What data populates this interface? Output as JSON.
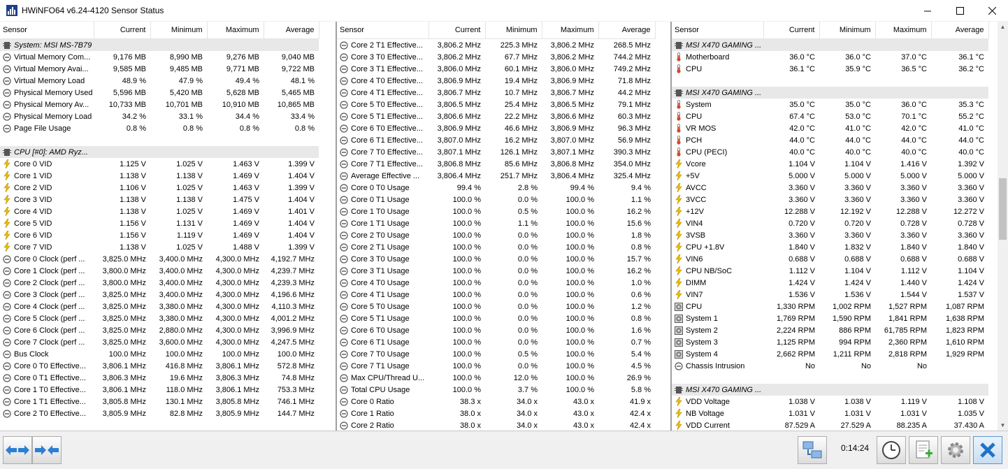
{
  "window": {
    "title": "HWiNFO64 v6.24-4120 Sensor Status"
  },
  "columns": [
    "Sensor",
    "Current",
    "Minimum",
    "Maximum",
    "Average"
  ],
  "pane1": [
    {
      "t": "g",
      "label": "System: MSI MS-7B79"
    },
    {
      "t": "r",
      "icon": "circle",
      "label": "Virtual Memory Com...",
      "cur": "9,176 MB",
      "min": "8,990 MB",
      "max": "9,276 MB",
      "avg": "9,040 MB"
    },
    {
      "t": "r",
      "icon": "circle",
      "label": "Virtual Memory Avai...",
      "cur": "9,585 MB",
      "min": "9,485 MB",
      "max": "9,771 MB",
      "avg": "9,722 MB"
    },
    {
      "t": "r",
      "icon": "circle",
      "label": "Virtual Memory Load",
      "cur": "48.9 %",
      "min": "47.9 %",
      "max": "49.4 %",
      "avg": "48.1 %"
    },
    {
      "t": "r",
      "icon": "circle",
      "label": "Physical Memory Used",
      "cur": "5,596 MB",
      "min": "5,420 MB",
      "max": "5,628 MB",
      "avg": "5,465 MB"
    },
    {
      "t": "r",
      "icon": "circle",
      "label": "Physical Memory Av...",
      "cur": "10,733 MB",
      "min": "10,701 MB",
      "max": "10,910 MB",
      "avg": "10,865 MB"
    },
    {
      "t": "r",
      "icon": "circle",
      "label": "Physical Memory Load",
      "cur": "34.2 %",
      "min": "33.1 %",
      "max": "34.4 %",
      "avg": "33.4 %"
    },
    {
      "t": "r",
      "icon": "circle",
      "label": "Page File Usage",
      "cur": "0.8 %",
      "min": "0.8 %",
      "max": "0.8 %",
      "avg": "0.8 %"
    },
    {
      "t": "s"
    },
    {
      "t": "g",
      "label": "CPU [#0]: AMD Ryz..."
    },
    {
      "t": "r",
      "icon": "bolt",
      "label": "Core 0 VID",
      "cur": "1.125 V",
      "min": "1.025 V",
      "max": "1.463 V",
      "avg": "1.399 V"
    },
    {
      "t": "r",
      "icon": "bolt",
      "label": "Core 1 VID",
      "cur": "1.138 V",
      "min": "1.138 V",
      "max": "1.469 V",
      "avg": "1.404 V"
    },
    {
      "t": "r",
      "icon": "bolt",
      "label": "Core 2 VID",
      "cur": "1.106 V",
      "min": "1.025 V",
      "max": "1.463 V",
      "avg": "1.399 V"
    },
    {
      "t": "r",
      "icon": "bolt",
      "label": "Core 3 VID",
      "cur": "1.138 V",
      "min": "1.138 V",
      "max": "1.475 V",
      "avg": "1.404 V"
    },
    {
      "t": "r",
      "icon": "bolt",
      "label": "Core 4 VID",
      "cur": "1.138 V",
      "min": "1.025 V",
      "max": "1.469 V",
      "avg": "1.401 V"
    },
    {
      "t": "r",
      "icon": "bolt",
      "label": "Core 5 VID",
      "cur": "1.156 V",
      "min": "1.131 V",
      "max": "1.469 V",
      "avg": "1.404 V"
    },
    {
      "t": "r",
      "icon": "bolt",
      "label": "Core 6 VID",
      "cur": "1.156 V",
      "min": "1.119 V",
      "max": "1.469 V",
      "avg": "1.404 V"
    },
    {
      "t": "r",
      "icon": "bolt",
      "label": "Core 7 VID",
      "cur": "1.138 V",
      "min": "1.025 V",
      "max": "1.488 V",
      "avg": "1.399 V"
    },
    {
      "t": "r",
      "icon": "circle",
      "label": "Core 0 Clock (perf ...",
      "cur": "3,825.0 MHz",
      "min": "3,400.0 MHz",
      "max": "4,300.0 MHz",
      "avg": "4,192.7 MHz"
    },
    {
      "t": "r",
      "icon": "circle",
      "label": "Core 1 Clock (perf ...",
      "cur": "3,800.0 MHz",
      "min": "3,400.0 MHz",
      "max": "4,300.0 MHz",
      "avg": "4,239.7 MHz"
    },
    {
      "t": "r",
      "icon": "circle",
      "label": "Core 2 Clock (perf ...",
      "cur": "3,800.0 MHz",
      "min": "3,400.0 MHz",
      "max": "4,300.0 MHz",
      "avg": "4,239.3 MHz"
    },
    {
      "t": "r",
      "icon": "circle",
      "label": "Core 3 Clock (perf ...",
      "cur": "3,825.0 MHz",
      "min": "3,400.0 MHz",
      "max": "4,300.0 MHz",
      "avg": "4,196.6 MHz"
    },
    {
      "t": "r",
      "icon": "circle",
      "label": "Core 4 Clock (perf ...",
      "cur": "3,825.0 MHz",
      "min": "3,380.0 MHz",
      "max": "4,300.0 MHz",
      "avg": "4,110.3 MHz"
    },
    {
      "t": "r",
      "icon": "circle",
      "label": "Core 5 Clock (perf ...",
      "cur": "3,825.0 MHz",
      "min": "3,380.0 MHz",
      "max": "4,300.0 MHz",
      "avg": "4,001.2 MHz"
    },
    {
      "t": "r",
      "icon": "circle",
      "label": "Core 6 Clock (perf ...",
      "cur": "3,825.0 MHz",
      "min": "2,880.0 MHz",
      "max": "4,300.0 MHz",
      "avg": "3,996.9 MHz"
    },
    {
      "t": "r",
      "icon": "circle",
      "label": "Core 7 Clock (perf ...",
      "cur": "3,825.0 MHz",
      "min": "3,600.0 MHz",
      "max": "4,300.0 MHz",
      "avg": "4,247.5 MHz"
    },
    {
      "t": "r",
      "icon": "circle",
      "label": "Bus Clock",
      "cur": "100.0 MHz",
      "min": "100.0 MHz",
      "max": "100.0 MHz",
      "avg": "100.0 MHz"
    },
    {
      "t": "r",
      "icon": "circle",
      "label": "Core 0 T0 Effective...",
      "cur": "3,806.1 MHz",
      "min": "416.8 MHz",
      "max": "3,806.1 MHz",
      "avg": "572.8 MHz"
    },
    {
      "t": "r",
      "icon": "circle",
      "label": "Core 0 T1 Effective...",
      "cur": "3,806.3 MHz",
      "min": "19.6 MHz",
      "max": "3,806.3 MHz",
      "avg": "74.8 MHz"
    },
    {
      "t": "r",
      "icon": "circle",
      "label": "Core 1 T0 Effective...",
      "cur": "3,806.1 MHz",
      "min": "118.0 MHz",
      "max": "3,806.1 MHz",
      "avg": "753.3 MHz"
    },
    {
      "t": "r",
      "icon": "circle",
      "label": "Core 1 T1 Effective...",
      "cur": "3,805.8 MHz",
      "min": "130.1 MHz",
      "max": "3,805.8 MHz",
      "avg": "746.1 MHz"
    },
    {
      "t": "r",
      "icon": "circle",
      "label": "Core 2 T0 Effective...",
      "cur": "3,805.9 MHz",
      "min": "82.8 MHz",
      "max": "3,805.9 MHz",
      "avg": "144.7 MHz"
    }
  ],
  "pane2": [
    {
      "t": "r",
      "icon": "circle",
      "label": "Core 2 T1 Effective...",
      "cur": "3,806.2 MHz",
      "min": "225.3 MHz",
      "max": "3,806.2 MHz",
      "avg": "268.5 MHz"
    },
    {
      "t": "r",
      "icon": "circle",
      "label": "Core 3 T0 Effective...",
      "cur": "3,806.2 MHz",
      "min": "67.7 MHz",
      "max": "3,806.2 MHz",
      "avg": "744.2 MHz"
    },
    {
      "t": "r",
      "icon": "circle",
      "label": "Core 3 T1 Effective...",
      "cur": "3,806.0 MHz",
      "min": "60.1 MHz",
      "max": "3,806.0 MHz",
      "avg": "749.2 MHz"
    },
    {
      "t": "r",
      "icon": "circle",
      "label": "Core 4 T0 Effective...",
      "cur": "3,806.9 MHz",
      "min": "19.4 MHz",
      "max": "3,806.9 MHz",
      "avg": "71.8 MHz"
    },
    {
      "t": "r",
      "icon": "circle",
      "label": "Core 4 T1 Effective...",
      "cur": "3,806.7 MHz",
      "min": "10.7 MHz",
      "max": "3,806.7 MHz",
      "avg": "44.2 MHz"
    },
    {
      "t": "r",
      "icon": "circle",
      "label": "Core 5 T0 Effective...",
      "cur": "3,806.5 MHz",
      "min": "25.4 MHz",
      "max": "3,806.5 MHz",
      "avg": "79.1 MHz"
    },
    {
      "t": "r",
      "icon": "circle",
      "label": "Core 5 T1 Effective...",
      "cur": "3,806.6 MHz",
      "min": "22.2 MHz",
      "max": "3,806.6 MHz",
      "avg": "60.3 MHz"
    },
    {
      "t": "r",
      "icon": "circle",
      "label": "Core 6 T0 Effective...",
      "cur": "3,806.9 MHz",
      "min": "46.6 MHz",
      "max": "3,806.9 MHz",
      "avg": "96.3 MHz"
    },
    {
      "t": "r",
      "icon": "circle",
      "label": "Core 6 T1 Effective...",
      "cur": "3,807.0 MHz",
      "min": "16.2 MHz",
      "max": "3,807.0 MHz",
      "avg": "56.9 MHz"
    },
    {
      "t": "r",
      "icon": "circle",
      "label": "Core 7 T0 Effective...",
      "cur": "3,807.1 MHz",
      "min": "126.1 MHz",
      "max": "3,807.1 MHz",
      "avg": "390.3 MHz"
    },
    {
      "t": "r",
      "icon": "circle",
      "label": "Core 7 T1 Effective...",
      "cur": "3,806.8 MHz",
      "min": "85.6 MHz",
      "max": "3,806.8 MHz",
      "avg": "354.0 MHz"
    },
    {
      "t": "r",
      "icon": "circle",
      "label": "Average Effective ...",
      "cur": "3,806.4 MHz",
      "min": "251.7 MHz",
      "max": "3,806.4 MHz",
      "avg": "325.4 MHz"
    },
    {
      "t": "r",
      "icon": "circle",
      "label": "Core 0 T0 Usage",
      "cur": "99.4 %",
      "min": "2.8 %",
      "max": "99.4 %",
      "avg": "9.4 %"
    },
    {
      "t": "r",
      "icon": "circle",
      "label": "Core 0 T1 Usage",
      "cur": "100.0 %",
      "min": "0.0 %",
      "max": "100.0 %",
      "avg": "1.1 %"
    },
    {
      "t": "r",
      "icon": "circle",
      "label": "Core 1 T0 Usage",
      "cur": "100.0 %",
      "min": "0.5 %",
      "max": "100.0 %",
      "avg": "16.2 %"
    },
    {
      "t": "r",
      "icon": "circle",
      "label": "Core 1 T1 Usage",
      "cur": "100.0 %",
      "min": "1.1 %",
      "max": "100.0 %",
      "avg": "15.6 %"
    },
    {
      "t": "r",
      "icon": "circle",
      "label": "Core 2 T0 Usage",
      "cur": "100.0 %",
      "min": "0.0 %",
      "max": "100.0 %",
      "avg": "1.8 %"
    },
    {
      "t": "r",
      "icon": "circle",
      "label": "Core 2 T1 Usage",
      "cur": "100.0 %",
      "min": "0.0 %",
      "max": "100.0 %",
      "avg": "0.8 %"
    },
    {
      "t": "r",
      "icon": "circle",
      "label": "Core 3 T0 Usage",
      "cur": "100.0 %",
      "min": "0.0 %",
      "max": "100.0 %",
      "avg": "15.7 %"
    },
    {
      "t": "r",
      "icon": "circle",
      "label": "Core 3 T1 Usage",
      "cur": "100.0 %",
      "min": "0.0 %",
      "max": "100.0 %",
      "avg": "16.2 %"
    },
    {
      "t": "r",
      "icon": "circle",
      "label": "Core 4 T0 Usage",
      "cur": "100.0 %",
      "min": "0.0 %",
      "max": "100.0 %",
      "avg": "1.0 %"
    },
    {
      "t": "r",
      "icon": "circle",
      "label": "Core 4 T1 Usage",
      "cur": "100.0 %",
      "min": "0.0 %",
      "max": "100.0 %",
      "avg": "0.6 %"
    },
    {
      "t": "r",
      "icon": "circle",
      "label": "Core 5 T0 Usage",
      "cur": "100.0 %",
      "min": "0.0 %",
      "max": "100.0 %",
      "avg": "1.2 %"
    },
    {
      "t": "r",
      "icon": "circle",
      "label": "Core 5 T1 Usage",
      "cur": "100.0 %",
      "min": "0.0 %",
      "max": "100.0 %",
      "avg": "0.8 %"
    },
    {
      "t": "r",
      "icon": "circle",
      "label": "Core 6 T0 Usage",
      "cur": "100.0 %",
      "min": "0.0 %",
      "max": "100.0 %",
      "avg": "1.6 %"
    },
    {
      "t": "r",
      "icon": "circle",
      "label": "Core 6 T1 Usage",
      "cur": "100.0 %",
      "min": "0.0 %",
      "max": "100.0 %",
      "avg": "0.7 %"
    },
    {
      "t": "r",
      "icon": "circle",
      "label": "Core 7 T0 Usage",
      "cur": "100.0 %",
      "min": "0.5 %",
      "max": "100.0 %",
      "avg": "5.4 %"
    },
    {
      "t": "r",
      "icon": "circle",
      "label": "Core 7 T1 Usage",
      "cur": "100.0 %",
      "min": "0.0 %",
      "max": "100.0 %",
      "avg": "4.5 %"
    },
    {
      "t": "r",
      "icon": "circle",
      "label": "Max CPU/Thread U...",
      "cur": "100.0 %",
      "min": "12.0 %",
      "max": "100.0 %",
      "avg": "26.9 %"
    },
    {
      "t": "r",
      "icon": "circle",
      "label": "Total CPU Usage",
      "cur": "100.0 %",
      "min": "3.7 %",
      "max": "100.0 %",
      "avg": "5.8 %"
    },
    {
      "t": "r",
      "icon": "circle",
      "label": "Core 0 Ratio",
      "cur": "38.3 x",
      "min": "34.0 x",
      "max": "43.0 x",
      "avg": "41.9 x"
    },
    {
      "t": "r",
      "icon": "circle",
      "label": "Core 1 Ratio",
      "cur": "38.0 x",
      "min": "34.0 x",
      "max": "43.0 x",
      "avg": "42.4 x"
    },
    {
      "t": "r",
      "icon": "circle",
      "label": "Core 2 Ratio",
      "cur": "38.0 x",
      "min": "34.0 x",
      "max": "43.0 x",
      "avg": "42.4 x"
    }
  ],
  "pane3": [
    {
      "t": "g",
      "label": "MSI X470 GAMING ..."
    },
    {
      "t": "r",
      "icon": "therm",
      "label": "Motherboard",
      "cur": "36.0 °C",
      "min": "36.0 °C",
      "max": "37.0 °C",
      "avg": "36.1 °C"
    },
    {
      "t": "r",
      "icon": "therm",
      "label": "CPU",
      "cur": "36.1 °C",
      "min": "35.9 °C",
      "max": "36.5 °C",
      "avg": "36.2 °C"
    },
    {
      "t": "s"
    },
    {
      "t": "g",
      "label": "MSI X470 GAMING ..."
    },
    {
      "t": "r",
      "icon": "therm",
      "label": "System",
      "cur": "35.0 °C",
      "min": "35.0 °C",
      "max": "36.0 °C",
      "avg": "35.3 °C"
    },
    {
      "t": "r",
      "icon": "therm",
      "label": "CPU",
      "cur": "67.4 °C",
      "min": "53.0 °C",
      "max": "70.1 °C",
      "avg": "55.2 °C"
    },
    {
      "t": "r",
      "icon": "therm",
      "label": "VR MOS",
      "cur": "42.0 °C",
      "min": "41.0 °C",
      "max": "42.0 °C",
      "avg": "41.0 °C"
    },
    {
      "t": "r",
      "icon": "therm",
      "label": "PCH",
      "cur": "44.0 °C",
      "min": "44.0 °C",
      "max": "44.0 °C",
      "avg": "44.0 °C"
    },
    {
      "t": "r",
      "icon": "therm",
      "label": "CPU (PECI)",
      "cur": "40.0 °C",
      "min": "40.0 °C",
      "max": "40.0 °C",
      "avg": "40.0 °C"
    },
    {
      "t": "r",
      "icon": "bolt",
      "label": "Vcore",
      "cur": "1.104 V",
      "min": "1.104 V",
      "max": "1.416 V",
      "avg": "1.392 V"
    },
    {
      "t": "r",
      "icon": "bolt",
      "label": "+5V",
      "cur": "5.000 V",
      "min": "5.000 V",
      "max": "5.000 V",
      "avg": "5.000 V"
    },
    {
      "t": "r",
      "icon": "bolt",
      "label": "AVCC",
      "cur": "3.360 V",
      "min": "3.360 V",
      "max": "3.360 V",
      "avg": "3.360 V"
    },
    {
      "t": "r",
      "icon": "bolt",
      "label": "3VCC",
      "cur": "3.360 V",
      "min": "3.360 V",
      "max": "3.360 V",
      "avg": "3.360 V"
    },
    {
      "t": "r",
      "icon": "bolt",
      "label": "+12V",
      "cur": "12.288 V",
      "min": "12.192 V",
      "max": "12.288 V",
      "avg": "12.272 V"
    },
    {
      "t": "r",
      "icon": "bolt",
      "label": "VIN4",
      "cur": "0.720 V",
      "min": "0.720 V",
      "max": "0.728 V",
      "avg": "0.728 V"
    },
    {
      "t": "r",
      "icon": "bolt",
      "label": "3VSB",
      "cur": "3.360 V",
      "min": "3.360 V",
      "max": "3.360 V",
      "avg": "3.360 V"
    },
    {
      "t": "r",
      "icon": "bolt",
      "label": "CPU +1.8V",
      "cur": "1.840 V",
      "min": "1.832 V",
      "max": "1.840 V",
      "avg": "1.840 V"
    },
    {
      "t": "r",
      "icon": "bolt",
      "label": "VIN6",
      "cur": "0.688 V",
      "min": "0.688 V",
      "max": "0.688 V",
      "avg": "0.688 V"
    },
    {
      "t": "r",
      "icon": "bolt",
      "label": "CPU NB/SoC",
      "cur": "1.112 V",
      "min": "1.104 V",
      "max": "1.112 V",
      "avg": "1.104 V"
    },
    {
      "t": "r",
      "icon": "bolt",
      "label": "DIMM",
      "cur": "1.424 V",
      "min": "1.424 V",
      "max": "1.440 V",
      "avg": "1.424 V"
    },
    {
      "t": "r",
      "icon": "bolt",
      "label": "VIN7",
      "cur": "1.536 V",
      "min": "1.536 V",
      "max": "1.544 V",
      "avg": "1.537 V"
    },
    {
      "t": "r",
      "icon": "fan",
      "label": "CPU",
      "cur": "1,330 RPM",
      "min": "1,002 RPM",
      "max": "1,527 RPM",
      "avg": "1,087 RPM"
    },
    {
      "t": "r",
      "icon": "fan",
      "label": "System 1",
      "cur": "1,769 RPM",
      "min": "1,590 RPM",
      "max": "1,841 RPM",
      "avg": "1,638 RPM"
    },
    {
      "t": "r",
      "icon": "fan",
      "label": "System 2",
      "cur": "2,224 RPM",
      "min": "886 RPM",
      "max": "61,785 RPM",
      "avg": "1,823 RPM"
    },
    {
      "t": "r",
      "icon": "fan",
      "label": "System 3",
      "cur": "1,125 RPM",
      "min": "994 RPM",
      "max": "2,360 RPM",
      "avg": "1,610 RPM"
    },
    {
      "t": "r",
      "icon": "fan",
      "label": "System 4",
      "cur": "2,662 RPM",
      "min": "1,211 RPM",
      "max": "2,818 RPM",
      "avg": "1,929 RPM"
    },
    {
      "t": "r",
      "icon": "circle",
      "label": "Chassis Intrusion",
      "cur": "No",
      "min": "No",
      "max": "No",
      "avg": ""
    },
    {
      "t": "s"
    },
    {
      "t": "g",
      "label": "MSI X470 GAMING ..."
    },
    {
      "t": "r",
      "icon": "bolt",
      "label": "VDD Voltage",
      "cur": "1.038 V",
      "min": "1.038 V",
      "max": "1.119 V",
      "avg": "1.108 V"
    },
    {
      "t": "r",
      "icon": "bolt",
      "label": "NB Voltage",
      "cur": "1.031 V",
      "min": "1.031 V",
      "max": "1.031 V",
      "avg": "1.035 V"
    },
    {
      "t": "r",
      "icon": "bolt",
      "label": "VDD Current",
      "cur": "87.529 A",
      "min": "27.529 A",
      "max": "88.235 A",
      "avg": "37.430 A"
    }
  ],
  "toolbar": {
    "elapsed": "0:14:24"
  },
  "colors": {
    "accent": "#1e73c8",
    "bolt": "#f0c000",
    "therm": "#d24a2a"
  }
}
